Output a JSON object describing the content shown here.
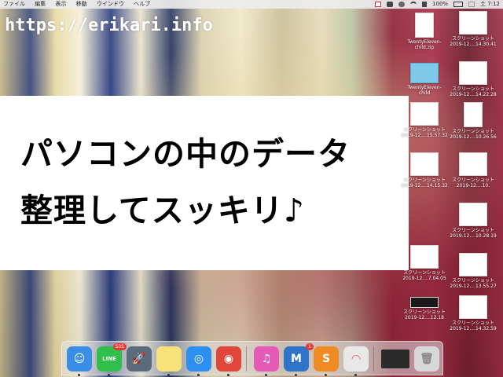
{
  "menubar": {
    "menus": [
      "ファイル",
      "編集",
      "表示",
      "移動",
      "ウインドウ",
      "ヘルプ"
    ],
    "battery": "100%",
    "clock": "土 7:12"
  },
  "watermark": "https://erikari.info",
  "banner": {
    "line1": "パソコンの中のデータ",
    "line2": "整理してスッキリ♪"
  },
  "desktop_icons": [
    {
      "name1": "TwentyEleven-",
      "name2": "child.zip",
      "kind": "doc"
    },
    {
      "name1": "スクリーンショット",
      "name2": "2019-12....14.30.41",
      "kind": "shot"
    },
    {
      "name1": "TwentyEleven-",
      "name2": "child",
      "kind": "folder"
    },
    {
      "name1": "スクリーンショット",
      "name2": "2019-12....14.22.28",
      "kind": "shot"
    },
    {
      "name1": "スクリーンショット",
      "name2": "2019-12....15.57.32",
      "kind": "shot"
    },
    {
      "name1": "スクリーンショット",
      "name2": "2019-12....10.26.56",
      "kind": "shot"
    },
    {
      "name1": "スクリーンショット",
      "name2": "2019-12....14.15.32",
      "kind": "shot"
    },
    {
      "name1": "スクリーンショット",
      "name2": "2019-12....10.",
      "kind": "shot"
    },
    {
      "name1": "スクリーンショット",
      "name2": "2019-12....10.28.19",
      "kind": "shot"
    },
    {
      "name1": "スクリーンショット",
      "name2": "2019-12....7.04.05",
      "kind": "shot"
    },
    {
      "name1": "スクリーンショット",
      "name2": "2019-12....13.55.27",
      "kind": "shot"
    },
    {
      "name1": "スクリーンショット",
      "name2": "2019-12....12.18",
      "kind": "dark"
    },
    {
      "name1": "スクリーンショット",
      "name2": "2019-12....14.32.59",
      "kind": "shot"
    }
  ],
  "dock": [
    {
      "name": "finder-icon",
      "glyph": "☺",
      "color": "#3a8ee6"
    },
    {
      "name": "line-icon",
      "glyph": "LINE",
      "color": "#2fbf4a",
      "badge": "505"
    },
    {
      "name": "launchpad-icon",
      "glyph": "🚀",
      "color": "#5b6b7c"
    },
    {
      "name": "notes-icon",
      "glyph": "",
      "color": "#f7e27a"
    },
    {
      "name": "safari-icon",
      "glyph": "◎",
      "color": "#2d8ff0"
    },
    {
      "name": "chrome-icon",
      "glyph": "◉",
      "color": "#e0473a"
    },
    {
      "name": "itunes-icon",
      "glyph": "♫",
      "color": "#e45ab6"
    },
    {
      "name": "mail-app-icon",
      "glyph": "M",
      "color": "#2e74c9",
      "badge": "1"
    },
    {
      "name": "sublime-icon",
      "glyph": "S",
      "color": "#f08a24"
    },
    {
      "name": "activity-icon",
      "glyph": "◠",
      "color": "#e8e8e8"
    },
    {
      "name": "screen-thumb-icon",
      "glyph": "",
      "color": "#2a2a2a"
    },
    {
      "name": "trash-icon",
      "glyph": "🗑",
      "color": "#d7d7d7"
    }
  ]
}
